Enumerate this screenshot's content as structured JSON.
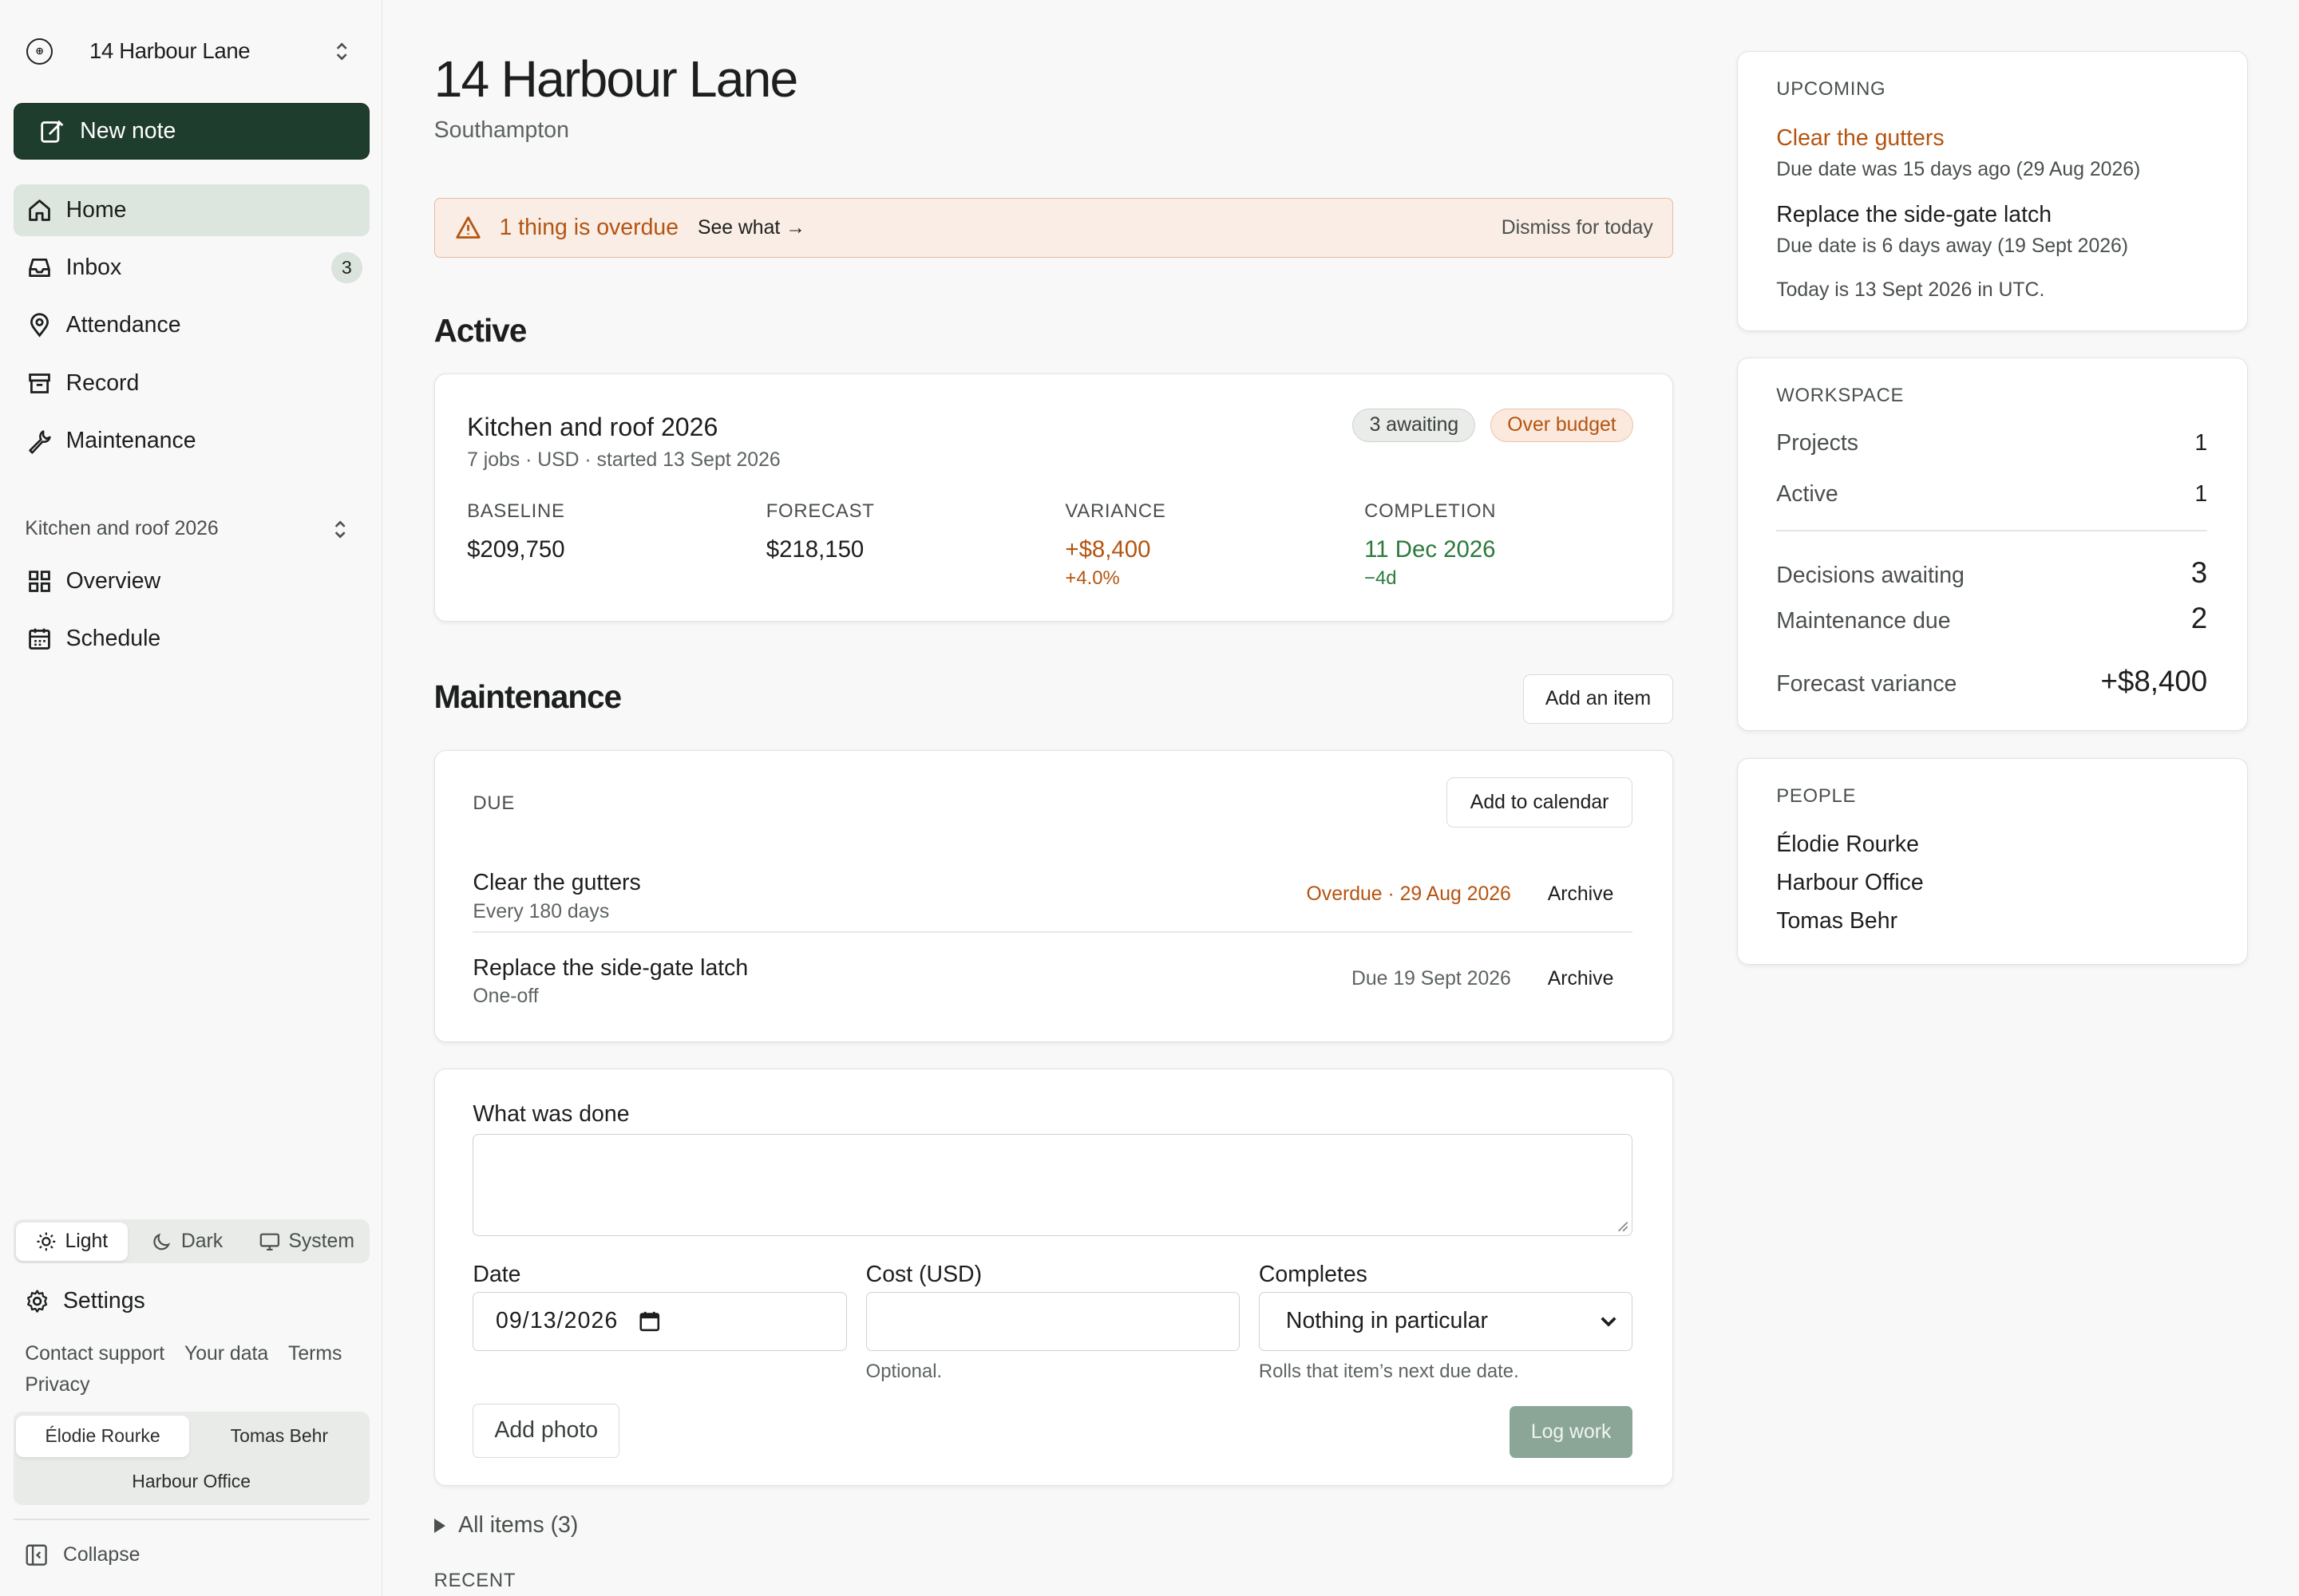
{
  "sidebar": {
    "workspace_name": "14 Harbour Lane",
    "new_note": "New note",
    "nav": [
      {
        "label": "Home",
        "icon": "home-icon"
      },
      {
        "label": "Inbox",
        "icon": "inbox-icon",
        "count": "3"
      },
      {
        "label": "Attendance",
        "icon": "map-pin-icon"
      },
      {
        "label": "Record",
        "icon": "archive-icon"
      },
      {
        "label": "Maintenance",
        "icon": "wrench-icon"
      }
    ],
    "project_name": "Kitchen and roof 2026",
    "project_nav": [
      {
        "label": "Overview",
        "icon": "grid-icon"
      },
      {
        "label": "Schedule",
        "icon": "calendar-icon"
      }
    ],
    "theme": {
      "light": "Light",
      "dark": "Dark",
      "system": "System"
    },
    "settings": "Settings",
    "links": {
      "support": "Contact support",
      "data": "Your data",
      "terms": "Terms",
      "privacy": "Privacy"
    },
    "people_switch": {
      "a": "Élodie Rourke",
      "b": "Tomas Behr",
      "c": "Harbour Office"
    },
    "collapse": "Collapse"
  },
  "main": {
    "title": "14 Harbour Lane",
    "subtitle": "Southampton",
    "alert": {
      "text": "1 thing is overdue",
      "link": "See what →",
      "dismiss": "Dismiss for today"
    },
    "active_title": "Active",
    "project": {
      "title": "Kitchen and roof 2026",
      "meta": "7 jobs · USD · started 13 Sept 2026",
      "pill_awaiting": "3 awaiting",
      "pill_budget": "Over budget",
      "stats": {
        "baseline_label": "BASELINE",
        "baseline": "$209,750",
        "forecast_label": "FORECAST",
        "forecast": "$218,150",
        "variance_label": "VARIANCE",
        "variance": "+$8,400",
        "variance_pct": "+4.0%",
        "completion_label": "COMPLETION",
        "completion": "11 Dec 2026",
        "completion_delta": "−4d"
      }
    },
    "maintenance_title": "Maintenance",
    "add_item": "Add an item",
    "due_label": "DUE",
    "add_calendar": "Add to calendar",
    "items": [
      {
        "title": "Clear the gutters",
        "sub": "Every 180 days",
        "due": "Overdue · 29 Aug 2026",
        "action": "Archive"
      },
      {
        "title": "Replace the side-gate latch",
        "sub": "One-off",
        "due": "Due 19 Sept 2026",
        "action": "Archive"
      }
    ],
    "form": {
      "what_label": "What was done",
      "date_label": "Date",
      "date_value": "09/13/2026",
      "cost_label": "Cost (USD)",
      "cost_help": "Optional.",
      "completes_label": "Completes",
      "completes_value": "Nothing in particular",
      "completes_help": "Rolls that item’s next due date.",
      "add_photo": "Add photo",
      "log_work": "Log work"
    },
    "all_items": "All items (3)",
    "recent_label": "RECENT"
  },
  "right": {
    "upcoming_label": "UPCOMING",
    "upcoming": [
      {
        "title": "Clear the gutters",
        "sub": "Due date was 15 days ago (29 Aug 2026)"
      },
      {
        "title": "Replace the side-gate latch",
        "sub": "Due date is 6 days away (19 Sept 2026)"
      }
    ],
    "today_note": "Today is 13 Sept 2026 in UTC.",
    "workspace_label": "WORKSPACE",
    "workspace": {
      "projects_k": "Projects",
      "projects_v": "1",
      "active_k": "Active",
      "active_v": "1",
      "decisions_k": "Decisions awaiting",
      "decisions_v": "3",
      "maint_k": "Maintenance due",
      "maint_v": "2",
      "variance_k": "Forecast variance",
      "variance_v": "+$8,400"
    },
    "people_label": "PEOPLE",
    "people": [
      "Élodie Rourke",
      "Harbour Office",
      "Tomas Behr"
    ]
  },
  "colors": {
    "brand": "#1f3d2d",
    "warning": "#b55410",
    "positive": "#2b7a3b",
    "active_nav": "#dde5df"
  }
}
